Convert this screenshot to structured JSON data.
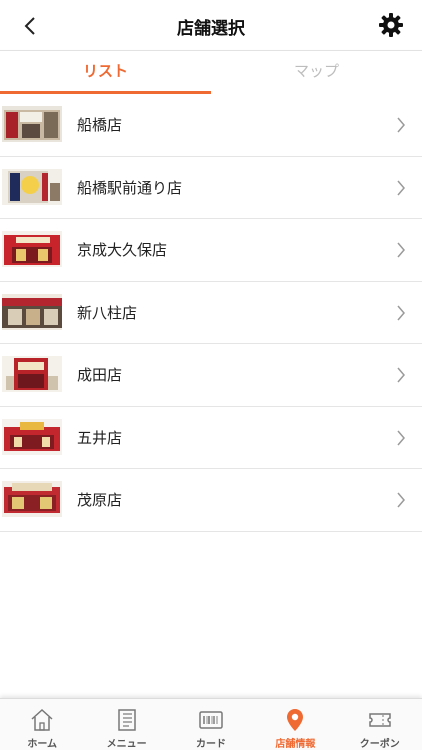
{
  "header": {
    "title": "店舗選択",
    "back_icon": "chevron-left-icon",
    "settings_icon": "gear-icon"
  },
  "tabs": [
    {
      "label": "リスト",
      "active": true
    },
    {
      "label": "マップ",
      "active": false
    }
  ],
  "stores": [
    {
      "name": "船橋店"
    },
    {
      "name": "船橋駅前通り店"
    },
    {
      "name": "京成大久保店"
    },
    {
      "name": "新八柱店"
    },
    {
      "name": "成田店"
    },
    {
      "name": "五井店"
    },
    {
      "name": "茂原店"
    }
  ],
  "bottom_nav": [
    {
      "label": "ホーム",
      "icon": "home-icon",
      "active": false
    },
    {
      "label": "メニュー",
      "icon": "menu-book-icon",
      "active": false
    },
    {
      "label": "カード",
      "icon": "barcode-card-icon",
      "active": false
    },
    {
      "label": "店舗情報",
      "icon": "map-pin-icon",
      "active": true
    },
    {
      "label": "クーポン",
      "icon": "coupon-ticket-icon",
      "active": false
    }
  ],
  "colors": {
    "accent": "#ef6a33",
    "inactive_tab": "#bdbdbd",
    "divider": "#e5e5e5"
  }
}
